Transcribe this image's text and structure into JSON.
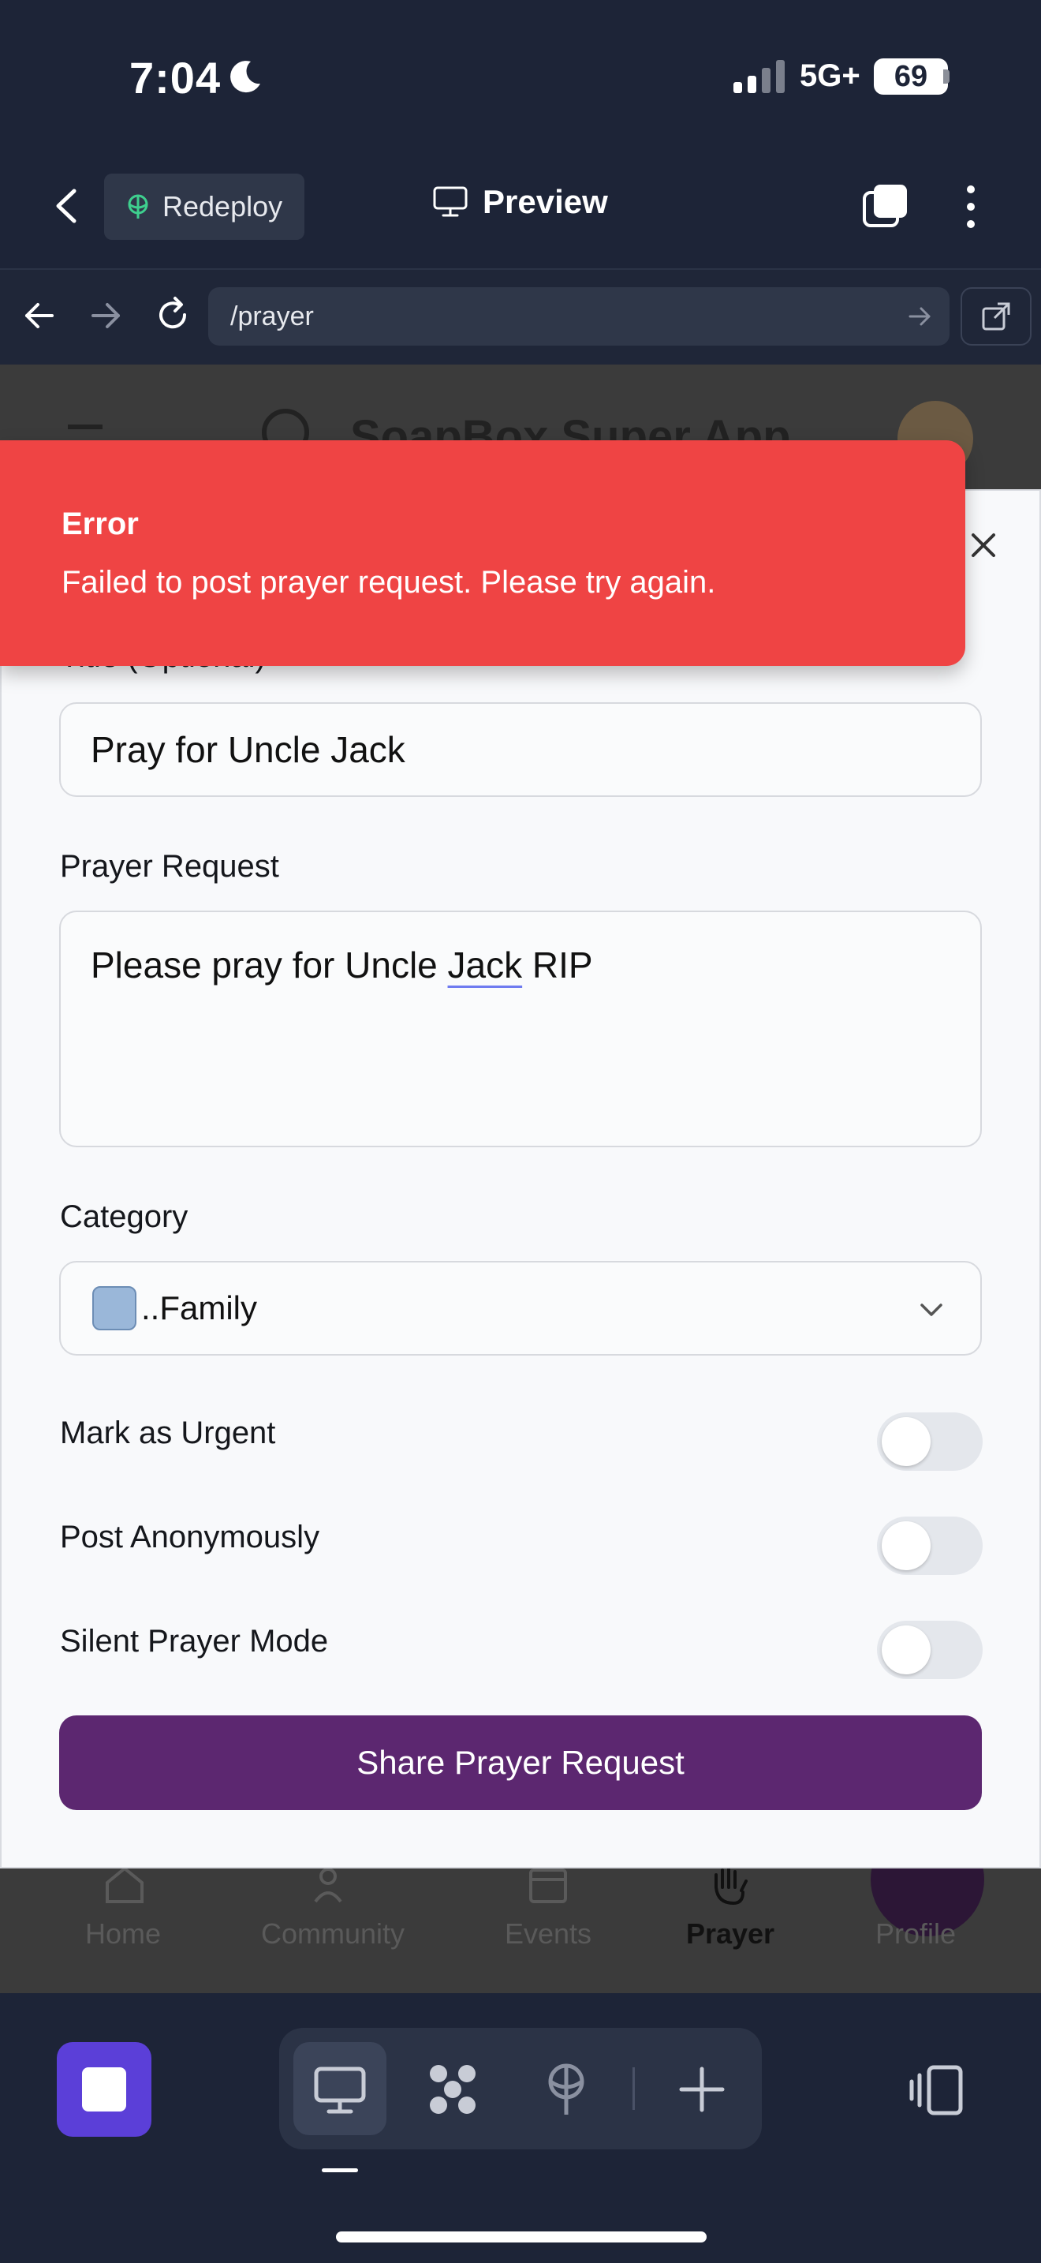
{
  "status_bar": {
    "time": "7:04",
    "network": "5G+",
    "battery": "69"
  },
  "top_bar": {
    "redeploy_label": "Redeploy",
    "preview_label": "Preview"
  },
  "browser": {
    "url": "/prayer"
  },
  "background_app": {
    "title": "SoapBox Super App",
    "nav": [
      {
        "label": "Home"
      },
      {
        "label": "Community"
      },
      {
        "label": "Events"
      },
      {
        "label": "Prayer"
      },
      {
        "label": "Profile"
      }
    ]
  },
  "toast": {
    "title": "Error",
    "message": "Failed to post prayer request. Please try again."
  },
  "form": {
    "title_label": "Title (Optional)",
    "title_value": "Pray for Uncle Jack",
    "request_label": "Prayer Request",
    "request_value_before": "Please pray for Uncle ",
    "request_value_misspelled": "Jack",
    "request_value_after": " RIP",
    "category_label": "Category",
    "category_value": "..Family",
    "toggles": [
      {
        "label": "Mark as Urgent",
        "on": false
      },
      {
        "label": "Post Anonymously",
        "on": false
      },
      {
        "label": "Silent Prayer Mode",
        "on": false
      }
    ],
    "submit_label": "Share Prayer Request"
  },
  "colors": {
    "toast_bg": "#ef4444",
    "submit_bg": "#5c2770",
    "toolbar_bg": "#1d2437",
    "stop_button": "#5b3fd8"
  }
}
